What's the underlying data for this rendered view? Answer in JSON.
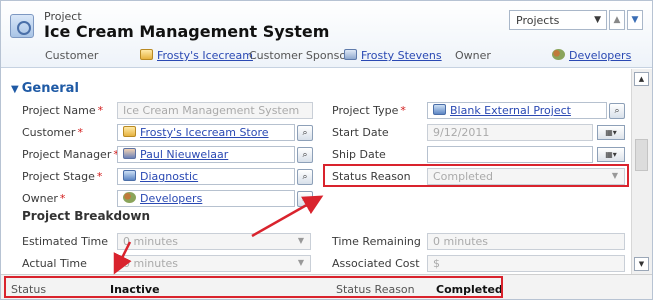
{
  "header": {
    "entity_label": "Project",
    "record_title": "Ice Cream Management System",
    "form_selector": "Projects",
    "fields": {
      "customer_label": "Customer",
      "customer_value": "Frosty's Icecream",
      "customer_sponsor_label": "Customer Sponsor",
      "customer_sponsor_value": "Frosty Stevens",
      "owner_label": "Owner",
      "owner_value": "Developers"
    }
  },
  "section": {
    "title": "General",
    "subsection_title": "Project Breakdown"
  },
  "fields": {
    "project_name": {
      "label": "Project Name",
      "value": "Ice Cream Management System"
    },
    "customer": {
      "label": "Customer",
      "value": "Frosty's Icecream Store"
    },
    "project_manager": {
      "label": "Project Manager",
      "value": "Paul Nieuwelaar"
    },
    "project_stage": {
      "label": "Project Stage",
      "value": "Diagnostic"
    },
    "owner": {
      "label": "Owner",
      "value": "Developers"
    },
    "project_type": {
      "label": "Project Type",
      "value": "Blank External Project"
    },
    "start_date": {
      "label": "Start Date",
      "value": "9/12/2011"
    },
    "ship_date": {
      "label": "Ship Date",
      "value": ""
    },
    "status_reason": {
      "label": "Status Reason",
      "value": "Completed"
    },
    "estimated_time": {
      "label": "Estimated Time",
      "value": "0 minutes"
    },
    "actual_time": {
      "label": "Actual Time",
      "value": "0 minutes"
    },
    "time_remaining": {
      "label": "Time Remaining",
      "value": "0 minutes"
    },
    "associated_cost": {
      "label": "Associated Cost",
      "value": "$"
    }
  },
  "footer": {
    "status_label": "Status",
    "status_value": "Inactive",
    "status_reason_label": "Status Reason",
    "status_reason_value": "Completed"
  },
  "colors": {
    "accent": "#1f5aa5",
    "link": "#2a49b3",
    "highlight": "#d9232d",
    "required": "#d21a1a"
  },
  "icons": {
    "entity": "project-icon",
    "customer": "account-icon",
    "contact": "contact-icon",
    "team": "team-icon",
    "user": "user-icon",
    "lookup": "lookup-icon",
    "calendar": "calendar-icon"
  }
}
